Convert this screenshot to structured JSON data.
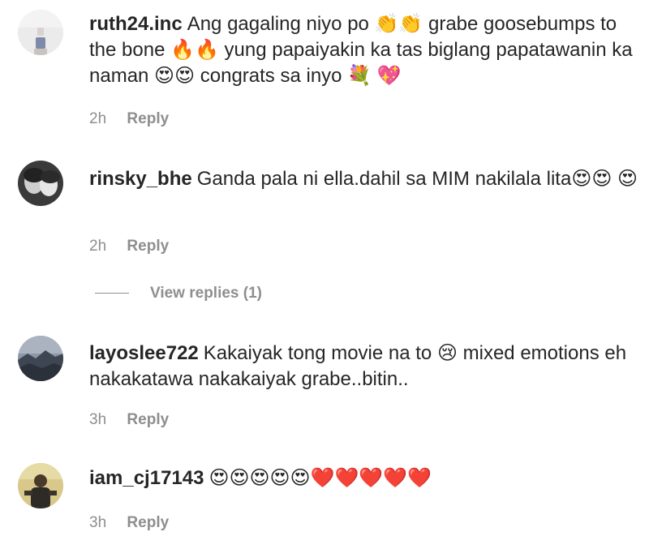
{
  "comments": [
    {
      "username": "ruth24.inc",
      "text": "Ang gagaling niyo po 👏👏 grabe goosebumps to the bone 🔥🔥 yung papaiyakin ka tas biglang papatawanin ka naman 😍😍 congrats sa inyo 💐 💖",
      "time": "2h",
      "reply_label": "Reply"
    },
    {
      "username": "rinsky_bhe",
      "text": "Ganda pala ni ella.dahil sa MIM nakilala lita😍😍 😍",
      "time": "2h",
      "reply_label": "Reply",
      "view_replies": "View replies (1)"
    },
    {
      "username": "layoslee722",
      "text": "Kakaiyak tong movie na to 😢 mixed emotions eh nakakatawa nakakaiyak grabe..bitin..",
      "time": "3h",
      "reply_label": "Reply"
    },
    {
      "username": "iam_cj17143",
      "text": "😍😍😍😍😍❤️❤️❤️❤️❤️",
      "time": "3h",
      "reply_label": "Reply"
    }
  ]
}
